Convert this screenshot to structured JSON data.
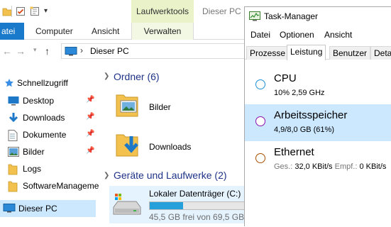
{
  "explorer": {
    "window_title": "Dieser PC",
    "ribbon": {
      "file_tab": "atei",
      "tabs": [
        "Computer",
        "Ansicht"
      ],
      "tools_header": "Laufwerktools",
      "tools_tab": "Verwalten"
    },
    "address": {
      "path": "Dieser PC"
    },
    "nav": {
      "quick_access": "Schnellzugriff",
      "items": [
        {
          "label": "Desktop",
          "icon": "desktop-icon",
          "pinned": true
        },
        {
          "label": "Downloads",
          "icon": "downloads-icon",
          "pinned": true
        },
        {
          "label": "Dokumente",
          "icon": "documents-icon",
          "pinned": true
        },
        {
          "label": "Bilder",
          "icon": "pictures-icon",
          "pinned": true
        },
        {
          "label": "Logs",
          "icon": "folder-icon",
          "pinned": false
        },
        {
          "label": "SoftwareManageme",
          "icon": "folder-icon",
          "pinned": false
        }
      ],
      "this_pc": "Dieser PC"
    },
    "content": {
      "folders_group": "Ordner (6)",
      "folders": [
        "Bilder",
        "Downloads"
      ],
      "devices_group": "Geräte und Laufwerke (2)",
      "drive": {
        "name": "Lokaler Datenträger (C:)",
        "free_text": "45,5 GB frei von 69,5 GB",
        "used_fraction": 0.35
      }
    }
  },
  "taskmanager": {
    "title": "Task-Manager",
    "menu": [
      "Datei",
      "Optionen",
      "Ansicht"
    ],
    "tabs": [
      "Prozesse",
      "Leistung",
      "Benutzer",
      "Detai"
    ],
    "active_tab": "Leistung",
    "resources": {
      "cpu": {
        "name": "CPU",
        "value": "10%  2,59 GHz",
        "color": "#1c8fd6"
      },
      "memory": {
        "name": "Arbeitsspeicher",
        "value": "4,9/8,0 GB (61%)",
        "color": "#8b12ae"
      },
      "ethernet": {
        "name": "Ethernet",
        "send_label": "Ges.:",
        "send_value": "32,0 KBit/s",
        "recv_label": "Empf.:",
        "recv_value": "0 KBit/s",
        "color": "#a74f01"
      }
    }
  },
  "colors": {
    "accent": "#1979ca",
    "selection": "#cce8ff",
    "group_header": "#1e3287"
  }
}
